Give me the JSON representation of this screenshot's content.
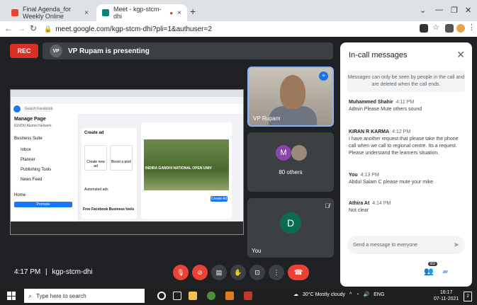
{
  "browser": {
    "tabs": [
      {
        "title": "Final Agenda_for Weekly Online"
      },
      {
        "title": "Meet - kgp-stcm-dhi"
      }
    ],
    "url": "meet.google.com/kgp-stcm-dhi?pli=1&authuser=2"
  },
  "meet": {
    "rec_label": "REC",
    "presenter_initials": "VP",
    "presenter_text": "VP Rupam is presenting",
    "tiles": {
      "rupam": "VP Rupam",
      "others_initial": "M",
      "others": "80 others",
      "you_initial": "D",
      "you": "You"
    },
    "clock": "4:17 PM",
    "sep": "|",
    "code": "kgp-stcm-dhi",
    "participants_badge": "83"
  },
  "shared": {
    "search": "Search Facebook",
    "manage_page": "Manage Page",
    "page_name": "IGNOU Alumni Network",
    "side_items": [
      "Business Suite",
      "Inbox",
      "Planner",
      "Publishing Tools",
      "News Feed"
    ],
    "home": "Home",
    "promote": "Promote",
    "create_ad": "Create ad",
    "create_new_ad": "Create new ad",
    "boost_post": "Boost a post",
    "automated_ads": "Automated ads",
    "free_tools": "Free Facebook Business tools",
    "photo_caption": "INDIRA GANDHI NATIONAL OPEN UNIV",
    "create_ad_btn": "Create Ad"
  },
  "chat": {
    "title": "In-call messages",
    "notice": "Messages can only be seen by people in the call and are deleted when the call ends.",
    "messages": [
      {
        "sender": "Muhammed Shahir",
        "time": "4:11 PM",
        "text": "Admin Please Mute others sound"
      },
      {
        "sender": "KIRAN R KARMA",
        "time": "4:12 PM",
        "text": "I have another request that please take the phone call when we call to regional centre. Its a request. Please understand the learners situation."
      },
      {
        "sender": "You",
        "time": "4:13 PM",
        "text": "Abdul Salam C please mute your mike"
      },
      {
        "sender": "Athira At",
        "time": "4:14 PM",
        "text": "Not clear"
      }
    ],
    "placeholder": "Send a message to everyone"
  },
  "taskbar": {
    "search": "Type here to search",
    "weather": "30°C  Mostly cloudy",
    "lang": "ENG",
    "time": "16:17",
    "date": "07-11-2021",
    "notif_count": "2"
  },
  "colors": {
    "accent": "#1a73e8",
    "danger": "#ea4335",
    "meet_bg": "#202124",
    "fb_blue": "#1877f2"
  }
}
